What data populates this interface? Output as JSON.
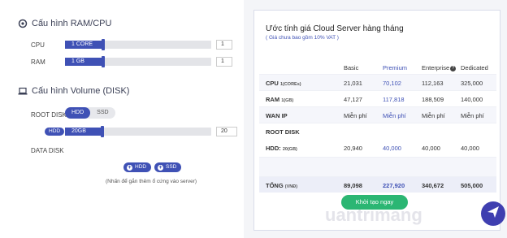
{
  "ram_cpu": {
    "title": "Cấu hình RAM/CPU",
    "cpu_label": "CPU",
    "cpu_value_label": "1 CORE",
    "cpu_input": "1",
    "ram_label": "RAM",
    "ram_value_label": "1 GB",
    "ram_input": "1"
  },
  "volume": {
    "title": "Cấu hình Volume (DISK)",
    "root_disk_label": "ROOT DISK",
    "disk_types": [
      "HDD",
      "SSD"
    ],
    "selected_type": "HDD",
    "disk_tag": "HDD",
    "disk_value_label": "20GB",
    "disk_input": "20",
    "data_disk_label": "DATA DISK",
    "add_hdd": "HDD",
    "add_ssd": "SSD",
    "hint": "(Nhấn để gắn thêm ổ cứng vào server)"
  },
  "estimate": {
    "title": "Ước tính giá Cloud Server hàng tháng",
    "subtitle": "( Giá chưa bao gồm 10% VAT )",
    "headers": [
      "Basic",
      "Premium",
      "Enterprise",
      "Dedicated"
    ],
    "rows": [
      {
        "label": "CPU",
        "unit": "1(COREs)",
        "values": [
          "21,031",
          "70,102",
          "112,163",
          "325,000"
        ]
      },
      {
        "label": "RAM",
        "unit": "1(GB)",
        "values": [
          "47,127",
          "117,818",
          "188,509",
          "140,000"
        ]
      },
      {
        "label": "WAN IP",
        "unit": "",
        "values": [
          "Miễn phí",
          "Miễn phí",
          "Miễn phí",
          "Miễn phí"
        ]
      },
      {
        "label": "ROOT DISK",
        "unit": "",
        "values": [
          "",
          "",
          "",
          ""
        ]
      },
      {
        "label": "HDD:",
        "unit": "20(GB)",
        "values": [
          "20,940",
          "40,000",
          "40,000",
          "40,000"
        ]
      }
    ],
    "total_label": "TỔNG",
    "total_unit": "(VNĐ)",
    "totals": [
      "89,098",
      "227,920",
      "340,672",
      "505,000"
    ],
    "cta": "Khởi tạo ngay"
  },
  "watermark": "uantrimang",
  "colors": {
    "accent": "#3f51b5",
    "cta": "#2bb673"
  }
}
